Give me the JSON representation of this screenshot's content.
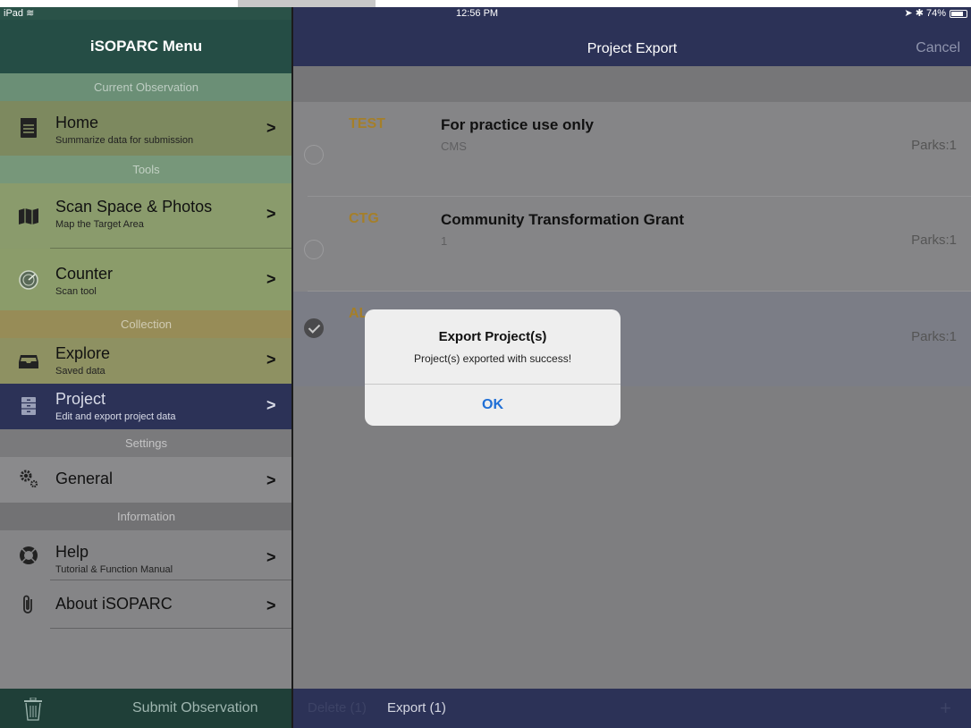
{
  "status_bar": {
    "device": "iPad",
    "time": "12:56 PM",
    "battery": "74%"
  },
  "sidebar": {
    "title": "iSOPARC Menu",
    "sections": {
      "current_observation": "Current Observation",
      "tools": "Tools",
      "collection": "Collection",
      "settings": "Settings",
      "information": "Information"
    },
    "items": {
      "home": {
        "title": "Home",
        "subtitle": "Summarize data for submission"
      },
      "scan": {
        "title": "Scan Space & Photos",
        "subtitle": "Map the Target Area"
      },
      "counter": {
        "title": "Counter",
        "subtitle": "Scan tool"
      },
      "explore": {
        "title": "Explore",
        "subtitle": "Saved data"
      },
      "project": {
        "title": "Project",
        "subtitle": "Edit and export project data"
      },
      "general": {
        "title": "General"
      },
      "help": {
        "title": "Help",
        "subtitle": "Tutorial & Function Manual"
      },
      "about": {
        "title": "About iSOPARC"
      }
    },
    "chevron": ">",
    "submit": "Submit Observation"
  },
  "main": {
    "title": "Project Export",
    "cancel": "Cancel",
    "projects": [
      {
        "code": "TEST",
        "name": "For practice use only",
        "description": "CMS",
        "parks": "Parks:1",
        "selected": false
      },
      {
        "code": "CTG",
        "name": "Community Transformation Grant",
        "description": "1",
        "parks": "Parks:1",
        "selected": false
      },
      {
        "code": "AL",
        "name": "",
        "description": "",
        "parks": "Parks:1",
        "selected": true
      }
    ],
    "toolbar": {
      "delete": "Delete (1)",
      "export": "Export (1)",
      "add": "+"
    }
  },
  "alert": {
    "title": "Export Project(s)",
    "message": "Project(s) exported with success!",
    "ok": "OK"
  },
  "colors": {
    "sidebar_bg": "#2a5248",
    "navbar_bg": "#2c3257",
    "project_code": "#a57f29",
    "alert_button": "#1f6fd6"
  }
}
